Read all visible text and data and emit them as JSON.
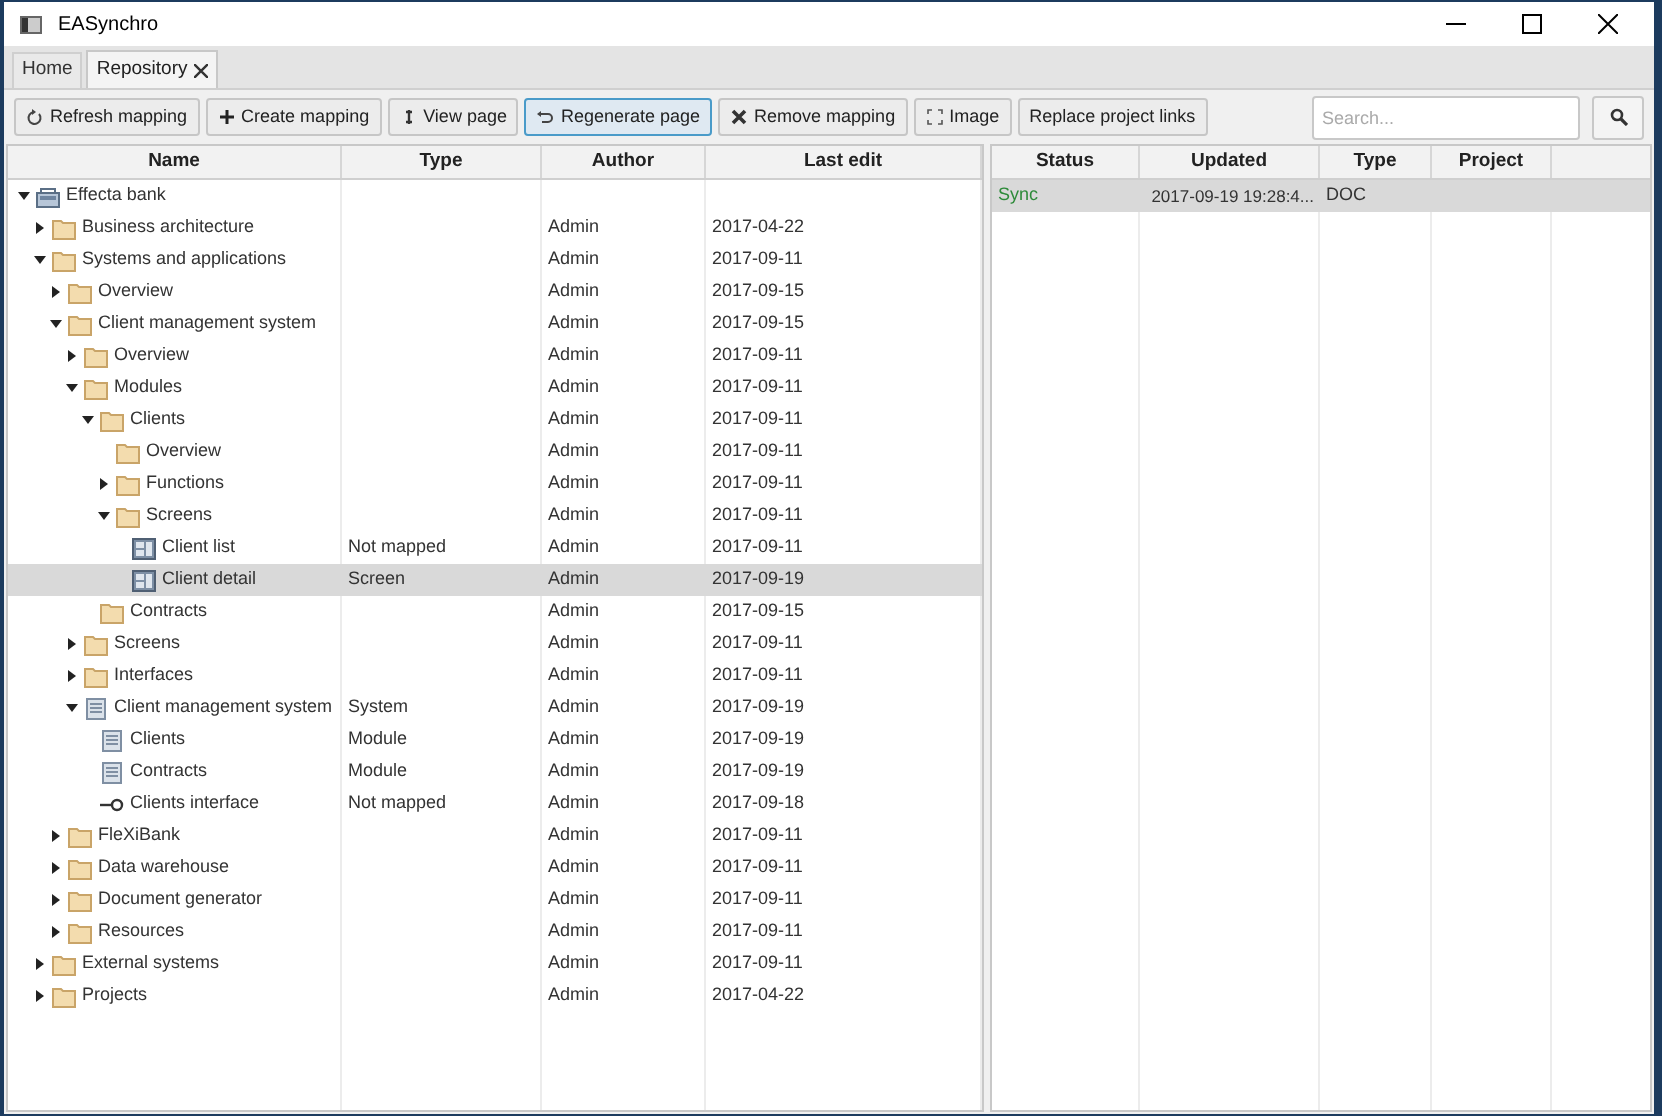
{
  "window": {
    "title": "EASynchro"
  },
  "tabs": [
    {
      "label": "Home",
      "selected": false,
      "closable": false
    },
    {
      "label": "Repository",
      "selected": true,
      "closable": true
    }
  ],
  "toolbar": [
    {
      "label": "Refresh mapping",
      "kind": "refresh",
      "focused": false
    },
    {
      "label": "Create mapping",
      "kind": "create",
      "focused": false
    },
    {
      "label": "View page",
      "kind": "view",
      "focused": false
    },
    {
      "label": "Regenerate page",
      "kind": "regenerate",
      "focused": true
    },
    {
      "label": "Remove mapping",
      "kind": "remove",
      "focused": false
    },
    {
      "label": "Image",
      "kind": "image",
      "focused": false
    },
    {
      "label": "Replace project links",
      "kind": "text",
      "focused": false
    }
  ],
  "search": {
    "placeholder": "Search..."
  },
  "tree": {
    "columns": [
      "Name",
      "Type",
      "Author",
      "Last edit"
    ],
    "rows": [
      {
        "name": "Effecta bank",
        "kind": "package",
        "expanded": true,
        "selected": false,
        "children": [
          {
            "name": "Business architecture",
            "kind": "folder",
            "expanded": false,
            "selected": false,
            "author": "Admin",
            "last_edit": "2017-04-22"
          },
          {
            "name": "Systems and applications",
            "kind": "folder",
            "expanded": true,
            "selected": false,
            "author": "Admin",
            "last_edit": "2017-09-11",
            "children": [
              {
                "name": "Overview",
                "kind": "folder",
                "expanded": false,
                "selected": false,
                "author": "Admin",
                "last_edit": "2017-09-15"
              },
              {
                "name": "Client management system",
                "kind": "folder",
                "expanded": true,
                "selected": false,
                "author": "Admin",
                "last_edit": "2017-09-15",
                "children": [
                  {
                    "name": "Overview",
                    "kind": "folder",
                    "expanded": false,
                    "selected": false,
                    "author": "Admin",
                    "last_edit": "2017-09-11"
                  },
                  {
                    "name": "Modules",
                    "kind": "folder",
                    "expanded": true,
                    "selected": false,
                    "author": "Admin",
                    "last_edit": "2017-09-11",
                    "children": [
                      {
                        "name": "Clients",
                        "kind": "folder",
                        "expanded": true,
                        "selected": false,
                        "author": "Admin",
                        "last_edit": "2017-09-11",
                        "children": [
                          {
                            "name": "Overview",
                            "kind": "folder",
                            "selected": false,
                            "author": "Admin",
                            "last_edit": "2017-09-11"
                          },
                          {
                            "name": "Functions",
                            "kind": "folder",
                            "expanded": false,
                            "selected": false,
                            "author": "Admin",
                            "last_edit": "2017-09-11"
                          },
                          {
                            "name": "Screens",
                            "kind": "folder",
                            "expanded": true,
                            "selected": false,
                            "author": "Admin",
                            "last_edit": "2017-09-11",
                            "children": [
                              {
                                "name": "Client list",
                                "kind": "screen",
                                "type": "Not mapped",
                                "selected": false,
                                "author": "Admin",
                                "last_edit": "2017-09-11"
                              },
                              {
                                "name": "Client detail",
                                "kind": "screen",
                                "type": "Screen",
                                "selected": true,
                                "author": "Admin",
                                "last_edit": "2017-09-19"
                              }
                            ]
                          }
                        ]
                      },
                      {
                        "name": "Contracts",
                        "kind": "folder",
                        "selected": false,
                        "author": "Admin",
                        "last_edit": "2017-09-15"
                      }
                    ]
                  },
                  {
                    "name": "Screens",
                    "kind": "folder",
                    "expanded": false,
                    "selected": false,
                    "author": "Admin",
                    "last_edit": "2017-09-11"
                  },
                  {
                    "name": "Interfaces",
                    "kind": "folder",
                    "expanded": false,
                    "selected": false,
                    "author": "Admin",
                    "last_edit": "2017-09-11"
                  },
                  {
                    "name": "Client management system",
                    "kind": "component",
                    "type": "System",
                    "expanded": true,
                    "selected": false,
                    "author": "Admin",
                    "last_edit": "2017-09-19",
                    "children": [
                      {
                        "name": "Clients",
                        "kind": "component",
                        "type": "Module",
                        "selected": false,
                        "author": "Admin",
                        "last_edit": "2017-09-19"
                      },
                      {
                        "name": "Contracts",
                        "kind": "component",
                        "type": "Module",
                        "selected": false,
                        "author": "Admin",
                        "last_edit": "2017-09-19"
                      },
                      {
                        "name": "Clients interface",
                        "kind": "interface",
                        "type": "Not mapped",
                        "selected": false,
                        "author": "Admin",
                        "last_edit": "2017-09-18"
                      }
                    ]
                  }
                ]
              },
              {
                "name": "FleXiBank",
                "kind": "folder",
                "expanded": false,
                "selected": false,
                "author": "Admin",
                "last_edit": "2017-09-11"
              },
              {
                "name": "Data warehouse",
                "kind": "folder",
                "expanded": false,
                "selected": false,
                "author": "Admin",
                "last_edit": "2017-09-11"
              },
              {
                "name": "Document generator",
                "kind": "folder",
                "expanded": false,
                "selected": false,
                "author": "Admin",
                "last_edit": "2017-09-11"
              },
              {
                "name": "Resources",
                "kind": "folder",
                "expanded": false,
                "selected": false,
                "author": "Admin",
                "last_edit": "2017-09-11"
              }
            ]
          },
          {
            "name": "External systems",
            "kind": "folder",
            "expanded": false,
            "selected": false,
            "author": "Admin",
            "last_edit": "2017-09-11"
          },
          {
            "name": "Projects",
            "kind": "folder",
            "expanded": false,
            "selected": false,
            "author": "Admin",
            "last_edit": "2017-04-22"
          }
        ]
      }
    ]
  },
  "pages": {
    "columns": [
      "Status",
      "Updated",
      "Type",
      "Project"
    ],
    "rows": [
      {
        "status": "Sync",
        "updated": "2017-09-19 19:28:4...",
        "type": "DOC",
        "selected": true
      }
    ]
  }
}
